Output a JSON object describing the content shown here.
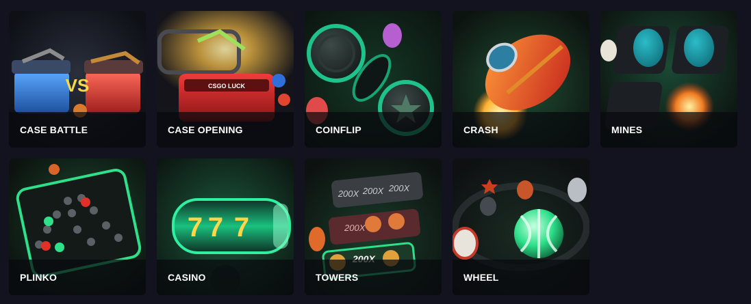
{
  "games": [
    {
      "label": "CASE BATTLE",
      "icon": "case-battle-icon"
    },
    {
      "label": "CASE OPENING",
      "icon": "case-opening-icon"
    },
    {
      "label": "COINFLIP",
      "icon": "coinflip-icon"
    },
    {
      "label": "CRASH",
      "icon": "crash-rocket-icon"
    },
    {
      "label": "MINES",
      "icon": "mines-eggs-icon"
    },
    {
      "label": "PLINKO",
      "icon": "plinko-board-icon"
    },
    {
      "label": "CASINO",
      "icon": "slot-reels-icon"
    },
    {
      "label": "TOWERS",
      "icon": "towers-icon"
    },
    {
      "label": "WHEEL",
      "icon": "balloons-wheel-icon"
    }
  ],
  "art_text": {
    "vs": "VS",
    "case_brand": "CSGO LUCK",
    "tower_rows": [
      [
        "200X",
        "200X",
        "200X"
      ],
      [
        "200X"
      ],
      [
        "200X"
      ]
    ],
    "slot_symbol": "7"
  }
}
